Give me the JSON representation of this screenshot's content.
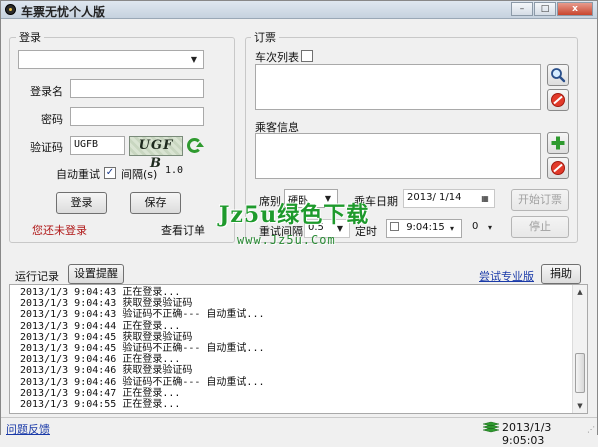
{
  "window": {
    "title": "车票无忧个人版",
    "min": "–",
    "max": "□",
    "close": "x"
  },
  "login": {
    "legend": "登录",
    "account_combo_value": "",
    "username_label": "登录名",
    "username_value": "",
    "password_label": "密码",
    "password_value": "",
    "captcha_label": "验证码",
    "captcha_value": "UGFB",
    "captcha_image_text": "UGF B",
    "auto_retry_label": "自动重试",
    "auto_retry_checked": "✓",
    "interval_label": "间隔(s)",
    "interval_value": "1.0",
    "login_button": "登录",
    "save_button": "保存",
    "status_text": "您还未登录",
    "view_orders": "查看订单"
  },
  "order": {
    "legend": "订票",
    "train_list_label": "车次列表",
    "passenger_label": "乘客信息",
    "seat_label": "席别",
    "seat_value": "硬卧",
    "date_label": "乘车日期",
    "date_value": "2013/ 1/14",
    "retry_interval_label": "重试间隔",
    "retry_interval_value": "0.5",
    "timer_label": "定时",
    "timer_value": "9:04:15",
    "timer_offset_value": "0",
    "start_button": "开始订票",
    "stop_button": "停止"
  },
  "log": {
    "label": "运行记录",
    "reminder_button": "设置提醒",
    "try_pro_link": "尝试专业版",
    "donate_button": "捐助",
    "lines": [
      "2013/1/3 9:04:43 正在登录...",
      "2013/1/3 9:04:43 获取登录验证码",
      "2013/1/3 9:04:43 验证码不正确--- 自动重试...",
      "2013/1/3 9:04:44 正在登录...",
      "2013/1/3 9:04:45 获取登录验证码",
      "2013/1/3 9:04:45 验证码不正确--- 自动重试...",
      "2013/1/3 9:04:46 正在登录...",
      "2013/1/3 9:04:46 获取登录验证码",
      "2013/1/3 9:04:46 验证码不正确--- 自动重试...",
      "2013/1/3 9:04:47 正在登录...",
      "2013/1/3 9:04:55 正在登录..."
    ]
  },
  "status": {
    "feedback_link": "问题反馈",
    "datetime": "2013/1/3 9:05:03"
  },
  "watermark": {
    "main": "Jz5u绿色下载",
    "sub": "www.Jz5u.Com"
  },
  "colors": {
    "accent_green": "#1e9a2c",
    "warning_red": "#b01818",
    "link_blue": "#1a3aa8"
  }
}
